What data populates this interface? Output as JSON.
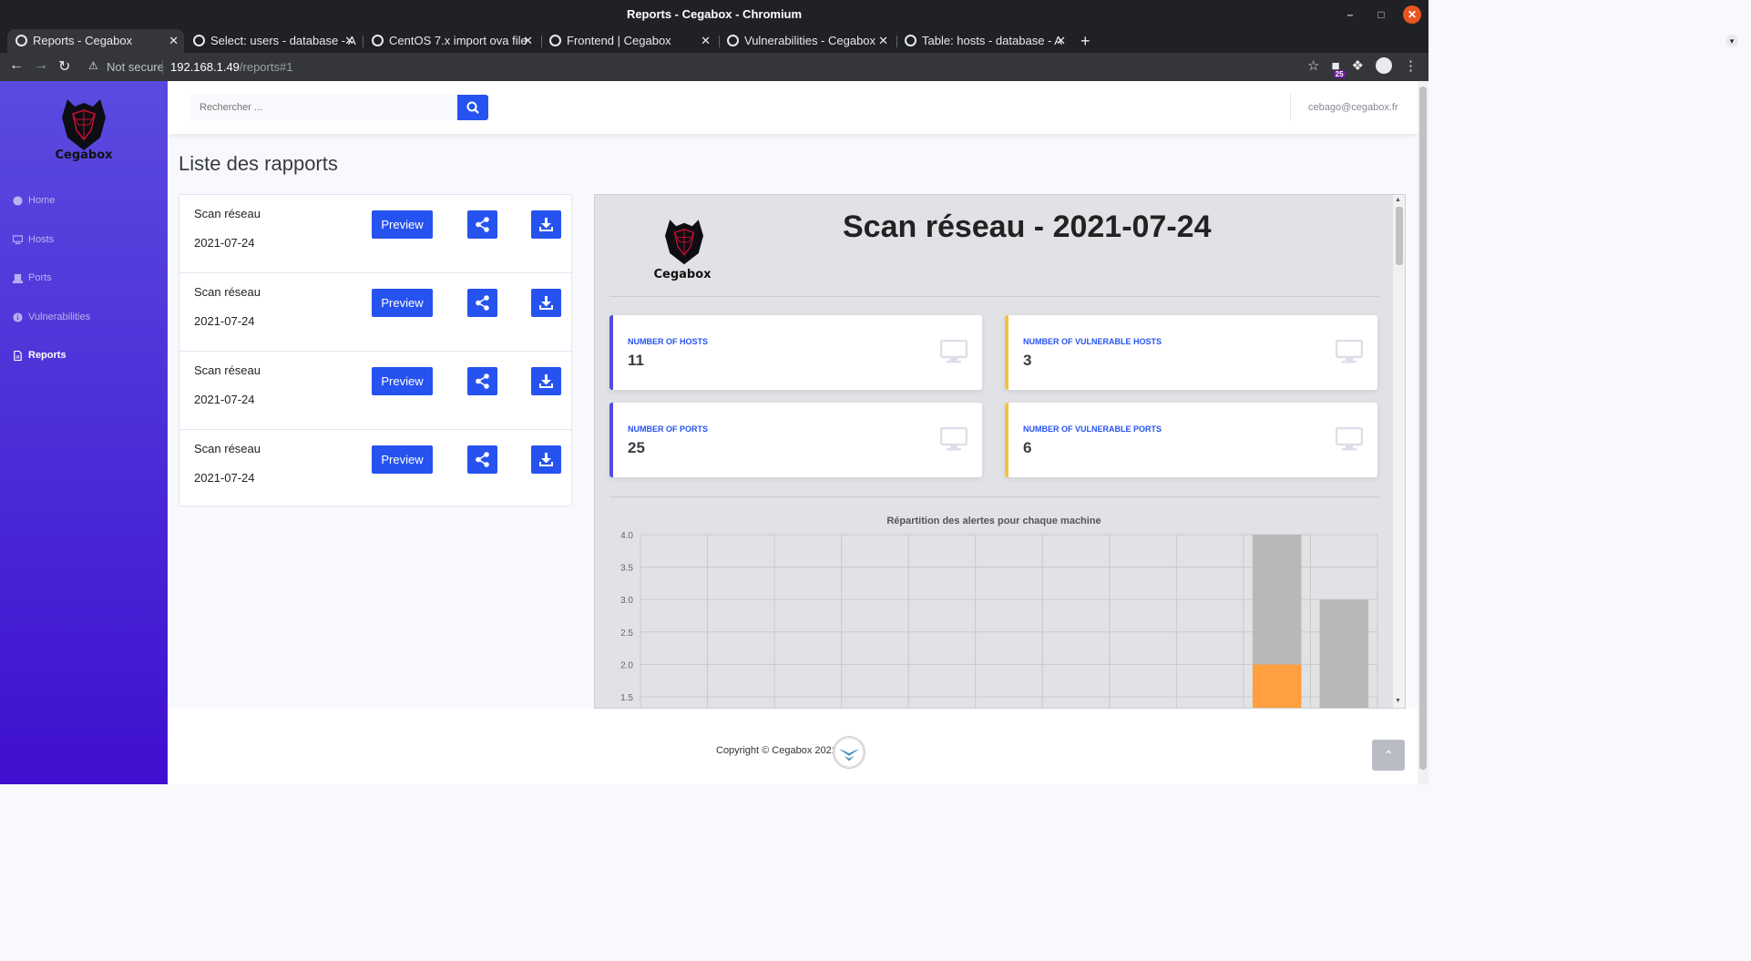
{
  "browser": {
    "window_title": "Reports - Cegabox - Chromium",
    "tabs": [
      {
        "label": "Reports - Cegabox"
      },
      {
        "label": "Select: users - database - A"
      },
      {
        "label": "CentOS 7.x import ova file"
      },
      {
        "label": "Frontend | Cegabox"
      },
      {
        "label": "Vulnerabilities - Cegabox"
      },
      {
        "label": "Table: hosts - database - A"
      }
    ],
    "not_secure": "Not secure",
    "url_host": "192.168.1.49",
    "url_path": "/reports#1",
    "extension_badge": "25"
  },
  "sidebar": {
    "brand": "Cegabox",
    "items": [
      {
        "label": "Home",
        "icon": "dashboard-icon"
      },
      {
        "label": "Hosts",
        "icon": "desktop-icon"
      },
      {
        "label": "Ports",
        "icon": "plug-icon"
      },
      {
        "label": "Vulnerabilities",
        "icon": "info-circle-icon"
      },
      {
        "label": "Reports",
        "icon": "file-icon"
      }
    ]
  },
  "header": {
    "search_placeholder": "Rechercher ...",
    "user_email": "cebago@cegabox.fr"
  },
  "main": {
    "title": "Liste des rapports",
    "reports": [
      {
        "name": "Scan réseau",
        "date": "2021-07-24",
        "preview_label": "Preview"
      },
      {
        "name": "Scan réseau",
        "date": "2021-07-24",
        "preview_label": "Preview"
      },
      {
        "name": "Scan réseau",
        "date": "2021-07-24",
        "preview_label": "Preview"
      },
      {
        "name": "Scan réseau",
        "date": "2021-07-24",
        "preview_label": "Preview"
      }
    ]
  },
  "preview": {
    "brand": "Cegabox",
    "title": "Scan réseau - 2021-07-24",
    "stats": [
      {
        "label": "NUMBER OF HOSTS",
        "value": "11",
        "accent": "#4e4fdc"
      },
      {
        "label": "NUMBER OF VULNERABLE HOSTS",
        "value": "3",
        "accent": "#f6c23e"
      },
      {
        "label": "NUMBER OF PORTS",
        "value": "25",
        "accent": "#4e4fdc"
      },
      {
        "label": "NUMBER OF VULNERABLE PORTS",
        "value": "6",
        "accent": "#f6c23e"
      }
    ]
  },
  "chart_data": {
    "type": "bar",
    "title": "Répartition des alertes pour chaque machine",
    "y_tick_labels": [
      "4.0",
      "3.5",
      "3.0",
      "2.5",
      "2.0",
      "1.5"
    ],
    "category_count": 11,
    "visible_ylim": [
      1.5,
      4.0
    ],
    "stacked": true,
    "series": [
      {
        "color": "#ff9f40",
        "values": [
          0,
          0,
          0,
          0,
          0,
          0,
          0,
          0,
          0,
          2,
          0
        ]
      },
      {
        "color": "#b8b8b8",
        "values": [
          0,
          0,
          0,
          0,
          0,
          0,
          0,
          0,
          0,
          2,
          3
        ]
      }
    ],
    "grid": true
  },
  "footer": {
    "copyright": "Copyright © Cegabox 2021"
  },
  "colors": {
    "primary": "#2653ef",
    "sidebar_top": "#5a4be0",
    "sidebar_bottom": "#3f0fcf"
  }
}
